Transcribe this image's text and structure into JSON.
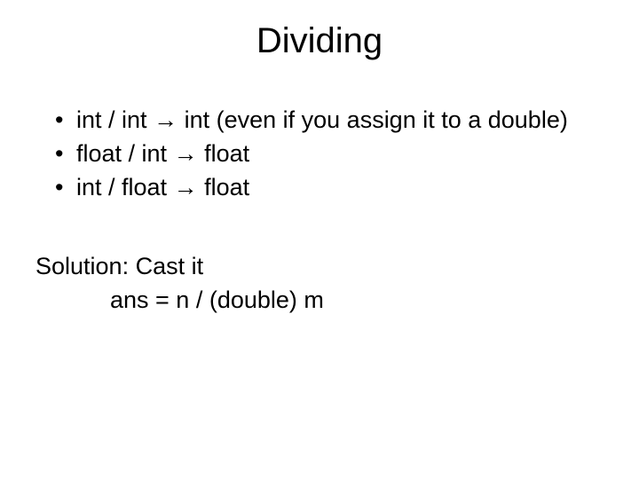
{
  "title": "Dividing",
  "bullets": [
    {
      "left": "int / int",
      "right": "int (even if you assign it to a double)"
    },
    {
      "left": "float / int",
      "right": "float"
    },
    {
      "left": "int / float",
      "right": "float"
    }
  ],
  "arrow": "→",
  "solution_label": "Solution: Cast it",
  "solution_code": "ans = n / (double) m"
}
